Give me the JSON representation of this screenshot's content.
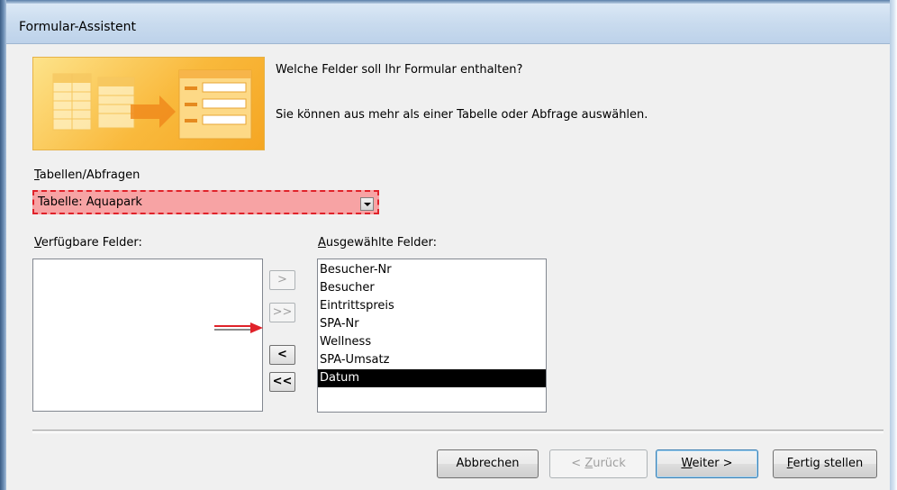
{
  "window": {
    "title": "Formular-Assistent"
  },
  "intro": {
    "question": "Welche Felder soll Ihr Formular enthalten?",
    "info": "Sie können aus mehr als einer Tabelle oder Abfrage auswählen."
  },
  "tables": {
    "label_accel": "T",
    "label_rest": "abellen/Abfragen",
    "selected_value": "Tabelle: Aquapark"
  },
  "available_fields": {
    "label_accel": "V",
    "label_rest": "erfügbare Felder:",
    "items": []
  },
  "selected_fields": {
    "label_accel": "A",
    "label_rest": "usgewählte Felder:",
    "items": [
      "Besucher-Nr",
      "Besucher",
      "Eintrittspreis",
      "SPA-Nr",
      "Wellness",
      "SPA-Umsatz",
      "Datum"
    ],
    "selected_item": "Datum"
  },
  "move_buttons": {
    "add_one": ">",
    "add_all": ">>",
    "remove_one": "<",
    "remove_all": "<<"
  },
  "footer": {
    "cancel": "Abbrechen",
    "back_prefix": "< ",
    "back_accel": "Z",
    "back_rest": "urück",
    "next_accel": "W",
    "next_rest": "eiter >",
    "finish_accel": "F",
    "finish_rest": "ertig stellen"
  },
  "colors": {
    "highlight_fill": "#f7a3a4",
    "highlight_border": "#e0222a",
    "hint_arrow": "#e0222a"
  }
}
